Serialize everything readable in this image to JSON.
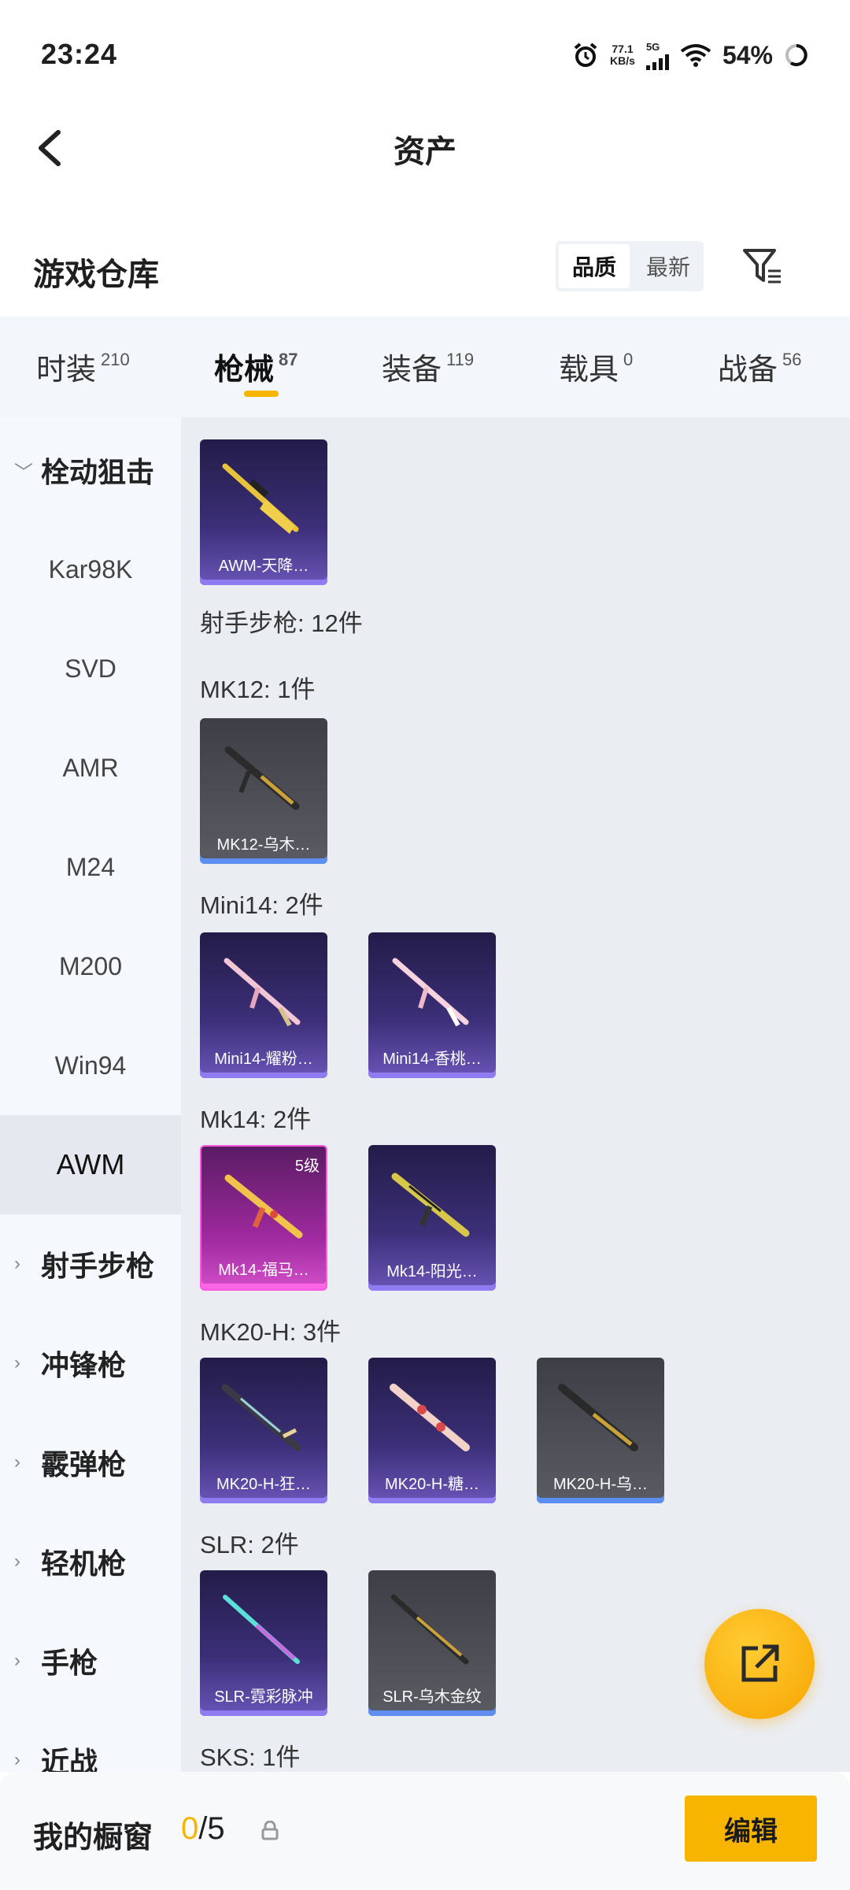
{
  "status": {
    "time": "23:24",
    "net_speed": "77.1",
    "net_unit": "KB/s",
    "signal": "5G",
    "battery": "54%"
  },
  "header": {
    "title": "资产"
  },
  "warehouse": {
    "title": "游戏仓库",
    "sort_quality": "品质",
    "sort_newest": "最新"
  },
  "tabs": [
    {
      "label": "时装",
      "count": "210"
    },
    {
      "label": "枪械",
      "count": "87"
    },
    {
      "label": "装备",
      "count": "119"
    },
    {
      "label": "载具",
      "count": "0"
    },
    {
      "label": "战备",
      "count": "56"
    }
  ],
  "sidebar": {
    "category_bolt": "栓动狙击",
    "items": [
      "Kar98K",
      "SVD",
      "AMR",
      "M24",
      "M200",
      "Win94",
      "AWM"
    ],
    "categories": [
      "射手步枪",
      "冲锋枪",
      "霰弹枪",
      "轻机枪",
      "手枪",
      "近战"
    ]
  },
  "content": {
    "awm_card": "AWM-天降…",
    "dmr_header": "射手步枪: 12件",
    "mk12_header": "MK12: 1件",
    "mk12_card": "MK12-乌木…",
    "mini14_header": "Mini14: 2件",
    "mini14_cards": [
      "Mini14-耀粉…",
      "Mini14-香桃…"
    ],
    "mk14_header": "Mk14: 2件",
    "mk14_cards": [
      "Mk14-福马…",
      "Mk14-阳光…"
    ],
    "mk14_level": "5级",
    "mk20_header": "MK20-H: 3件",
    "mk20_cards": [
      "MK20-H-狂…",
      "MK20-H-糖…",
      "MK20-H-乌…"
    ],
    "slr_header": "SLR: 2件",
    "slr_cards": [
      "SLR-霓彩脉冲",
      "SLR-乌木金纹"
    ],
    "sks_header": "SKS: 1件"
  },
  "bottom": {
    "title": "我的橱窗",
    "current": "0",
    "total": "/5",
    "edit": "编辑"
  },
  "colors": {
    "accent": "#f7b500",
    "purple_rarity": "#8f7cf0",
    "pink_rarity": "#ff59e0",
    "blue_rarity": "#5d8ef0"
  }
}
